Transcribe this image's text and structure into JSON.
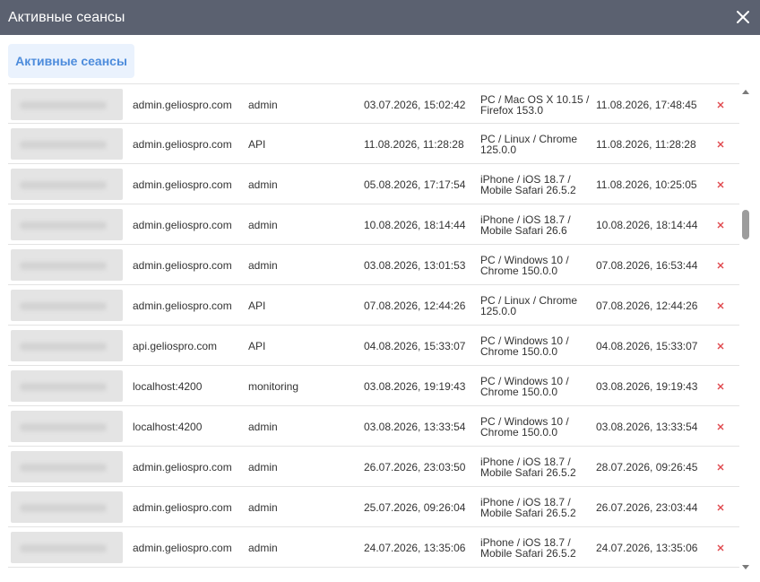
{
  "window": {
    "title": "Активные сеансы",
    "close_icon": "close-icon"
  },
  "tabs": [
    {
      "label": "Активные сеансы",
      "active": true
    }
  ],
  "colors": {
    "titlebar": "#5b6170",
    "tab_bg": "#eaf2fd",
    "tab_text": "#4d8cdc",
    "delete": "#e0484d"
  },
  "sessions": [
    {
      "host": "admin.geliospro.com",
      "user": "admin",
      "started": "03.07.2026, 15:02:42",
      "device": "PC / Mac OS X 10.15 / Firefox 153.0",
      "last_activity": "11.08.2026, 17:48:45"
    },
    {
      "host": "admin.geliospro.com",
      "user": "API",
      "started": "11.08.2026, 11:28:28",
      "device": "PC / Linux / Chrome 125.0.0",
      "last_activity": "11.08.2026, 11:28:28"
    },
    {
      "host": "admin.geliospro.com",
      "user": "admin",
      "started": "05.08.2026, 17:17:54",
      "device": "iPhone / iOS 18.7 / Mobile Safari 26.5.2",
      "last_activity": "11.08.2026, 10:25:05"
    },
    {
      "host": "admin.geliospro.com",
      "user": "admin",
      "started": "10.08.2026, 18:14:44",
      "device": "iPhone / iOS 18.7 / Mobile Safari 26.6",
      "last_activity": "10.08.2026, 18:14:44"
    },
    {
      "host": "admin.geliospro.com",
      "user": "admin",
      "started": "03.08.2026, 13:01:53",
      "device": "PC / Windows 10 / Chrome 150.0.0",
      "last_activity": "07.08.2026, 16:53:44"
    },
    {
      "host": "admin.geliospro.com",
      "user": "API",
      "started": "07.08.2026, 12:44:26",
      "device": "PC / Linux / Chrome 125.0.0",
      "last_activity": "07.08.2026, 12:44:26"
    },
    {
      "host": "api.geliospro.com",
      "user": "API",
      "started": "04.08.2026, 15:33:07",
      "device": "PC / Windows 10 / Chrome 150.0.0",
      "last_activity": "04.08.2026, 15:33:07"
    },
    {
      "host": "localhost:4200",
      "user": "monitoring",
      "started": "03.08.2026, 19:19:43",
      "device": "PC / Windows 10 / Chrome 150.0.0",
      "last_activity": "03.08.2026, 19:19:43"
    },
    {
      "host": "localhost:4200",
      "user": "admin",
      "started": "03.08.2026, 13:33:54",
      "device": "PC / Windows 10 / Chrome 150.0.0",
      "last_activity": "03.08.2026, 13:33:54"
    },
    {
      "host": "admin.geliospro.com",
      "user": "admin",
      "started": "26.07.2026, 23:03:50",
      "device": "iPhone / iOS 18.7 / Mobile Safari 26.5.2",
      "last_activity": "28.07.2026, 09:26:45"
    },
    {
      "host": "admin.geliospro.com",
      "user": "admin",
      "started": "25.07.2026, 09:26:04",
      "device": "iPhone / iOS 18.7 / Mobile Safari 26.5.2",
      "last_activity": "26.07.2026, 23:03:44"
    },
    {
      "host": "admin.geliospro.com",
      "user": "admin",
      "started": "24.07.2026, 13:35:06",
      "device": "iPhone / iOS 18.7 / Mobile Safari 26.5.2",
      "last_activity": "24.07.2026, 13:35:06"
    }
  ]
}
